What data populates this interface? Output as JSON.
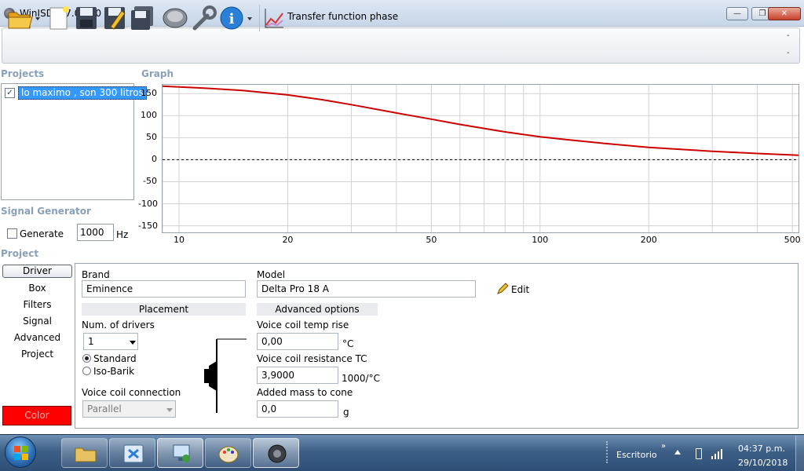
{
  "window": {
    "title": "WinISD 0.7.0.950"
  },
  "toolbar": {
    "mode_label": "Transfer function phase",
    "dash_top": "-",
    "dash_bottom": "-",
    "icons": [
      "open-folder-icon",
      "new-document-icon",
      "save-icon",
      "save-as-icon",
      "save-all-icon",
      "speaker-driver-icon",
      "wrench-icon",
      "info-icon",
      "chart-icon"
    ]
  },
  "sections": {
    "projects": "Projects",
    "graph": "Graph",
    "signal_generator": "Signal Generator",
    "project": "Project"
  },
  "projects": {
    "items": [
      {
        "label": "lo maximo , son  300 litros",
        "checked": true
      }
    ]
  },
  "signal_generator": {
    "generate_label": "Generate",
    "generate_checked": false,
    "frequency": "1000",
    "unit": "Hz"
  },
  "chart_data": {
    "type": "line",
    "y_ticks": [
      "150",
      "100",
      "50",
      "0",
      "-50",
      "-100",
      "-150"
    ],
    "x_ticks": [
      "10",
      "20",
      "50",
      "100",
      "200",
      "500"
    ],
    "x_scale": "log",
    "xlim": [
      9,
      520
    ],
    "ylim": [
      -165,
      170
    ],
    "grid": true,
    "reference_line": {
      "y": 0,
      "style": "dashed"
    },
    "series": [
      {
        "color": "#cc0000",
        "x": [
          9,
          10,
          12,
          15,
          20,
          25,
          30,
          40,
          50,
          60,
          70,
          80,
          100,
          120,
          150,
          200,
          250,
          300,
          400,
          520
        ],
        "y": [
          167,
          165,
          162,
          157,
          147,
          136,
          125,
          106,
          92,
          80,
          71,
          63,
          52,
          45,
          37,
          28,
          23,
          19,
          14,
          10
        ]
      }
    ]
  },
  "nav": {
    "items": [
      "Driver",
      "Box",
      "Filters",
      "Signal",
      "Advanced",
      "Project"
    ],
    "selected": "Driver",
    "color_button": "Color",
    "color_value": "#ff0000"
  },
  "driver": {
    "brand_label": "Brand",
    "brand_value": "Eminence",
    "model_label": "Model",
    "model_value": "Delta Pro 18 A",
    "edit_label": "Edit",
    "placement_header": "Placement",
    "num_drivers_label": "Num. of drivers",
    "num_drivers_value": "1",
    "radio_standard": "Standard",
    "radio_isobarik": "Iso-Barik",
    "placement_selected": "Standard",
    "vc_connection_label": "Voice coil connection",
    "vc_connection_value": "Parallel",
    "advanced_header": "Advanced options",
    "vc_temp_rise_label": "Voice coil temp rise",
    "vc_temp_rise_value": "0,00",
    "vc_temp_rise_unit": "°C",
    "vc_res_tc_label": "Voice coil resistance TC",
    "vc_res_tc_value": "3,9000",
    "vc_res_tc_unit": "1000/°C",
    "added_mass_label": "Added mass to cone",
    "added_mass_value": "0,0",
    "added_mass_unit": "g"
  },
  "taskbar": {
    "desktop_label": "Escritorio",
    "time": "04:37 p.m.",
    "date": "29/10/2018",
    "apps": [
      "explorer-icon",
      "control-panel-icon",
      "network-icon",
      "paint-icon",
      "winisd-icon"
    ]
  }
}
